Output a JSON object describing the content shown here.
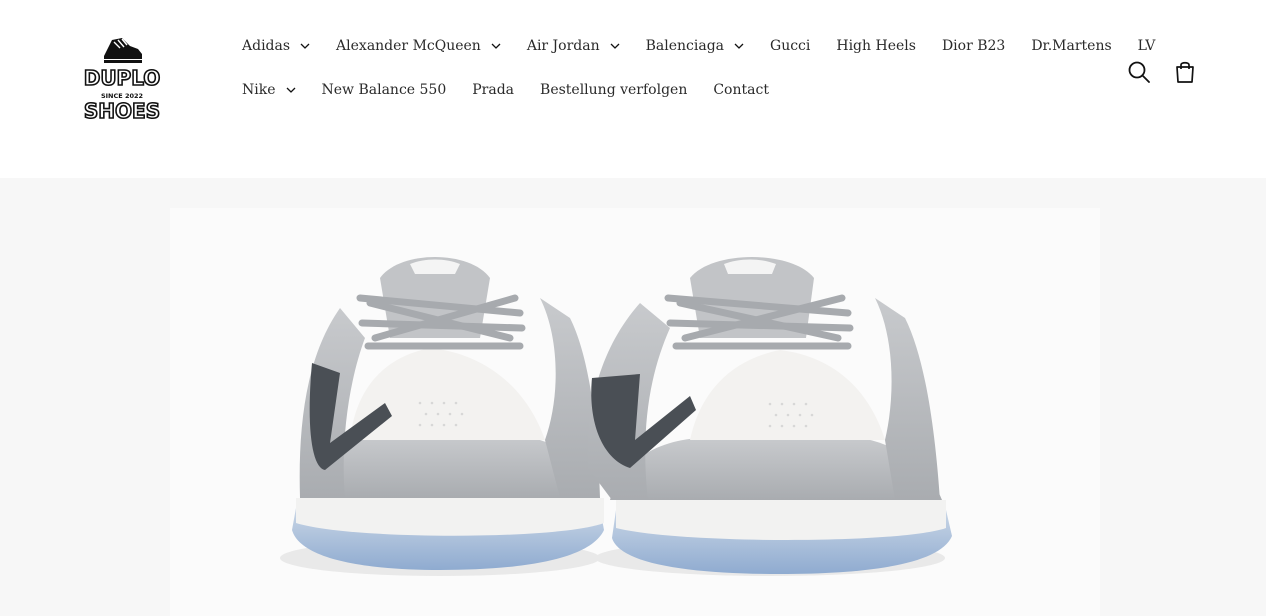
{
  "brand": {
    "logo_text_top": "DUPLO",
    "logo_text_tagline": "SINCE 2022",
    "logo_text_bottom": "SHOES"
  },
  "nav": {
    "row1": [
      {
        "label": "Adidas",
        "dropdown": true
      },
      {
        "label": "Alexander McQueen",
        "dropdown": true
      },
      {
        "label": "Air Jordan",
        "dropdown": true
      },
      {
        "label": "Balenciaga",
        "dropdown": true
      },
      {
        "label": "Gucci",
        "dropdown": false
      },
      {
        "label": "High Heels",
        "dropdown": false
      },
      {
        "label": "Dior B23",
        "dropdown": false
      },
      {
        "label": "Dr.Martens",
        "dropdown": false
      },
      {
        "label": "LV",
        "dropdown": false
      }
    ],
    "row2": [
      {
        "label": "Nike",
        "dropdown": true
      },
      {
        "label": "New Balance 550",
        "dropdown": false
      },
      {
        "label": "Prada",
        "dropdown": false
      },
      {
        "label": "Bestellung verfolgen",
        "dropdown": false
      },
      {
        "label": "Contact",
        "dropdown": false
      }
    ]
  },
  "header_icons": {
    "search": "search-icon",
    "cart": "cart-icon"
  },
  "hero": {
    "image": "grey-white-sneakers-pair"
  },
  "colors": {
    "text": "#121212",
    "nav_text": "#2a2a2a",
    "hero_bg": "#f7f7f7",
    "shoe_grey": "#b9bcc0",
    "shoe_white": "#f1f1f0",
    "sole_blue": "#9fb7d6",
    "swoosh_dark": "#4a4f55"
  }
}
